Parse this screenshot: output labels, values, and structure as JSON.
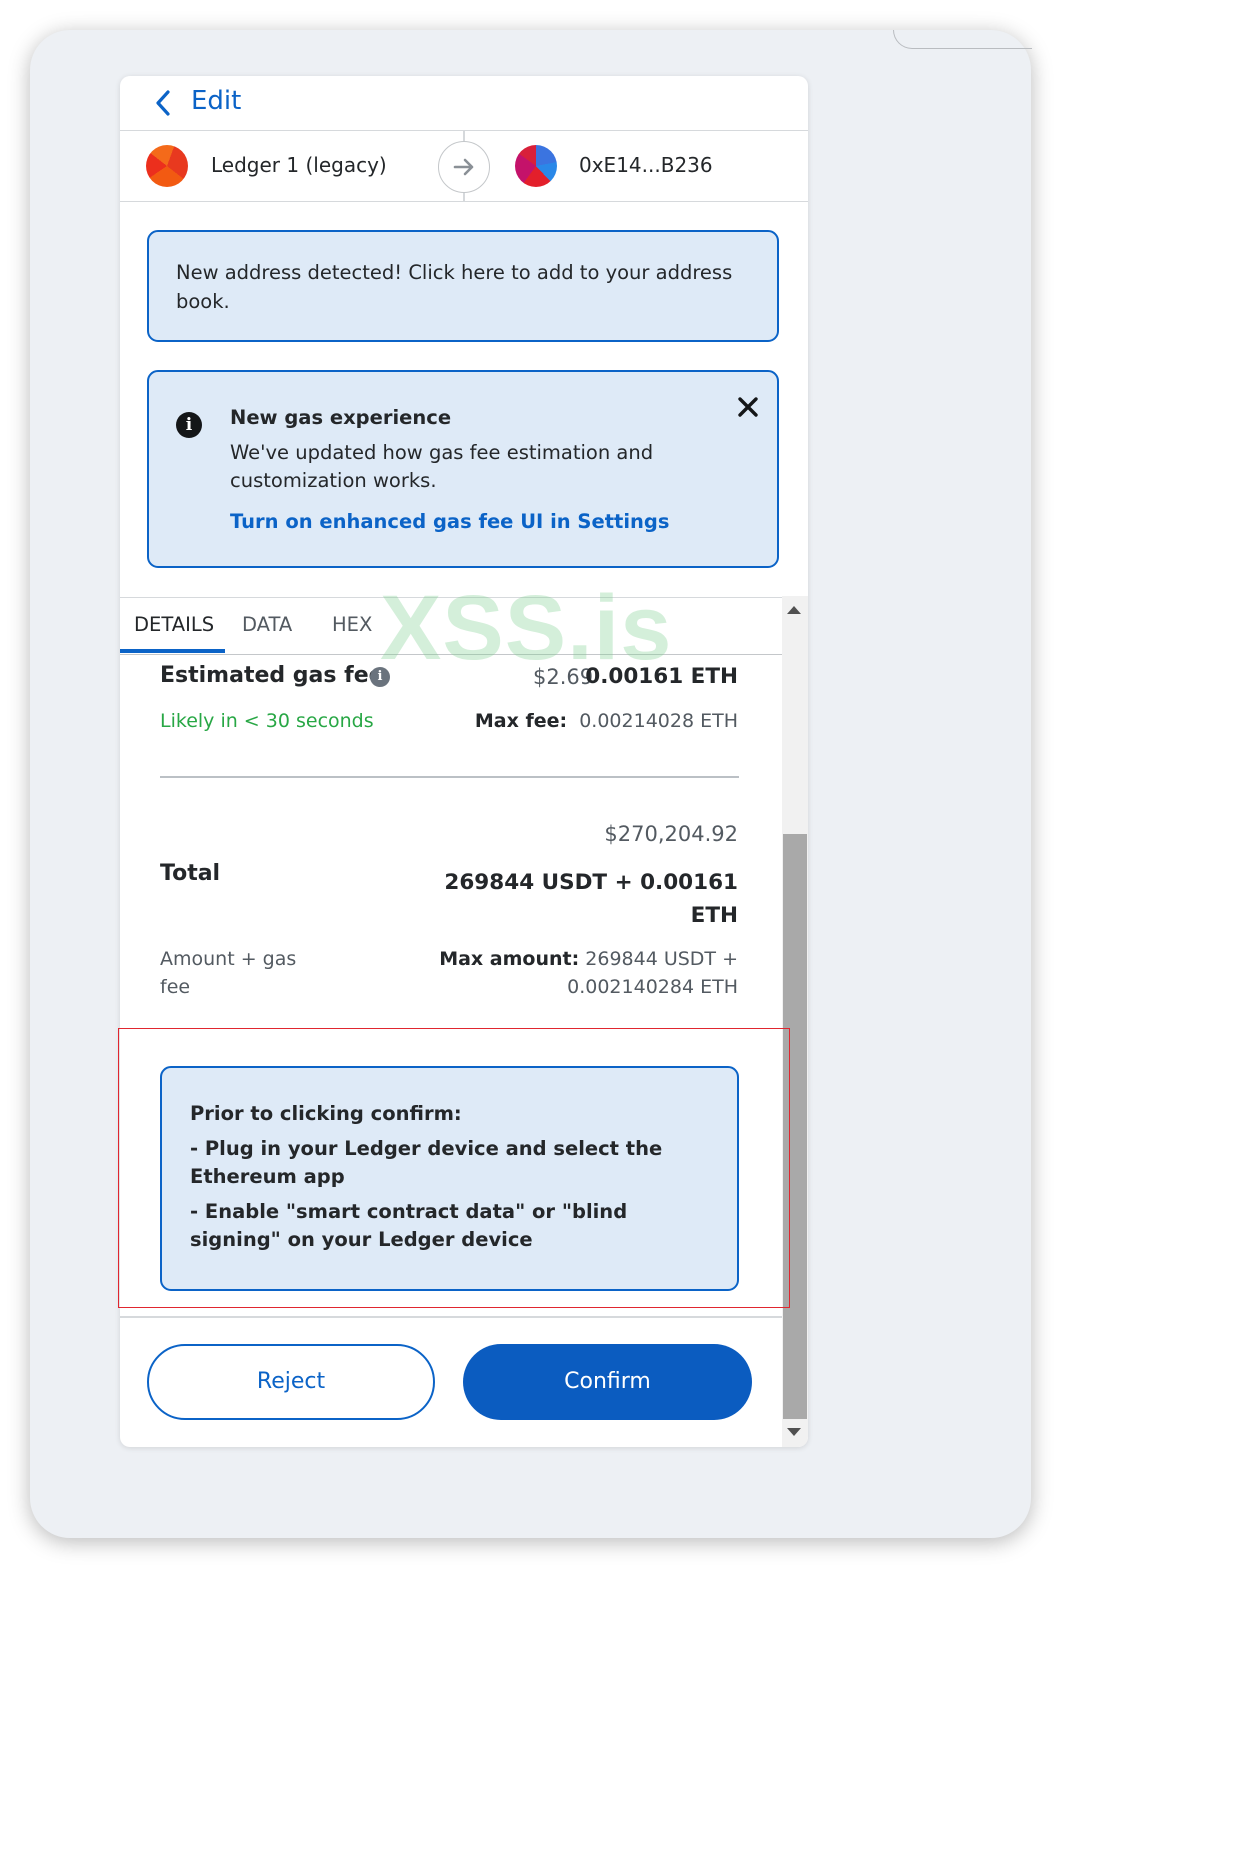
{
  "header": {
    "back_label": "Edit"
  },
  "accounts": {
    "from_name": "Ledger 1 (legacy)",
    "to_address": "0xE14...B236"
  },
  "notices": {
    "address_detected": "New address detected! Click here to add to your address book.",
    "gas_title": "New gas experience",
    "gas_body": "We've updated how gas fee estimation and customization works.",
    "gas_link": "Turn on enhanced gas fee UI in Settings"
  },
  "tabs": [
    {
      "label": "DETAILS",
      "active": true
    },
    {
      "label": "DATA",
      "active": false
    },
    {
      "label": "HEX",
      "active": false
    }
  ],
  "watermark": "XSS.is",
  "gas": {
    "label": "Estimated gas fee",
    "usd": "$2.69",
    "eth": "0.00161 ETH",
    "likely": "Likely in < 30 seconds",
    "max_fee_label": "Max fee:",
    "max_fee_value": "0.00214028 ETH"
  },
  "total": {
    "usd": "$270,204.92",
    "label": "Total",
    "amount": "269844 USDT + 0.00161 ETH",
    "subtitle": "Amount + gas fee",
    "max_amount_label": "Max amount:",
    "max_amount_value": "269844 USDT + 0.002140284 ETH"
  },
  "ledger_notice": {
    "title": "Prior to clicking confirm:",
    "step1": "- Plug in your Ledger device and select the Ethereum app",
    "step2": "- Enable \"smart contract data\" or \"blind signing\" on your Ledger device"
  },
  "buttons": {
    "reject": "Reject",
    "confirm": "Confirm"
  },
  "colors": {
    "accent": "#0b63c7",
    "notice_bg": "#deeaf7",
    "success": "#28a745",
    "highlight_border": "#e0262f"
  }
}
